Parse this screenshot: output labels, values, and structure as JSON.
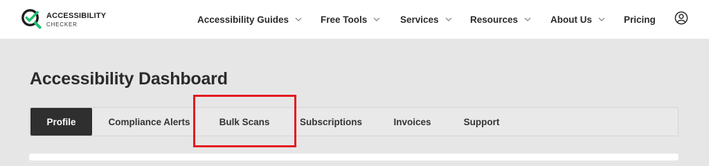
{
  "brand": {
    "title": "ACCESSIBILITY",
    "subtitle": "CHECKER",
    "accent_color": "#1fbf73",
    "dark_color": "#1e1e1e"
  },
  "nav": {
    "items": [
      {
        "label": "Accessibility Guides",
        "icon": "chevron-down-icon"
      },
      {
        "label": "Free Tools",
        "icon": "chevron-down-icon"
      },
      {
        "label": "Services",
        "icon": "chevron-down-icon"
      },
      {
        "label": "Resources",
        "icon": "chevron-down-icon"
      },
      {
        "label": "About Us",
        "icon": "chevron-down-icon"
      },
      {
        "label": "Pricing"
      }
    ],
    "account_icon": "user-account-icon"
  },
  "dashboard": {
    "title": "Accessibility Dashboard",
    "tabs": [
      {
        "label": "Profile",
        "active": true
      },
      {
        "label": "Compliance Alerts"
      },
      {
        "label": "Bulk Scans",
        "highlighted": true
      },
      {
        "label": "Subscriptions"
      },
      {
        "label": "Invoices"
      },
      {
        "label": "Support"
      }
    ],
    "highlight_color": "#e4191f"
  }
}
